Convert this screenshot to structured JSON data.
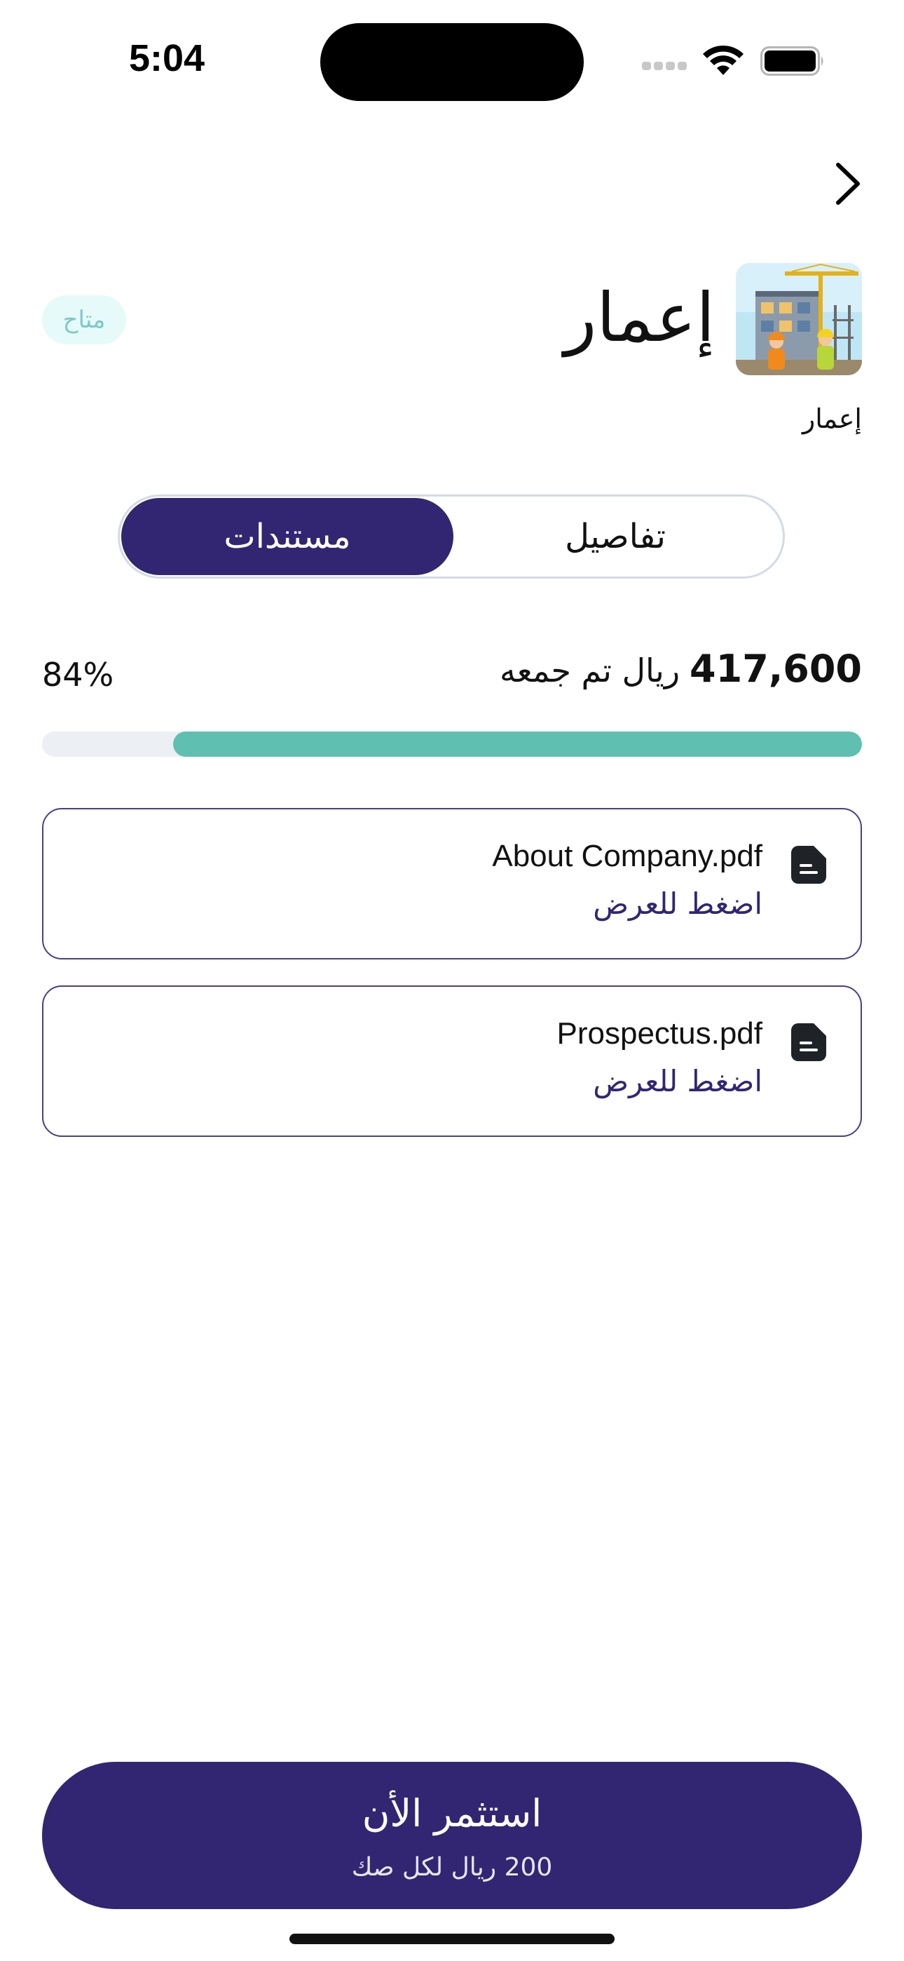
{
  "status_bar": {
    "time": "5:04"
  },
  "header": {
    "back_icon": "chevron-right-icon",
    "company_name": "إعمار",
    "company_subtitle": "إعمار",
    "status_badge": "متاح",
    "logo_icon": "construction-site-image"
  },
  "tabs": {
    "documents": "مستندات",
    "details": "تفاصيل",
    "selected": "documents"
  },
  "funding": {
    "amount": "417,600",
    "label": "ريال تم جمعه",
    "percent_text": "84%",
    "progress": 0.84
  },
  "documents": [
    {
      "name": "About Company.pdf",
      "action": "اضغط للعرض",
      "icon": "document-icon"
    },
    {
      "name": "Prospectus.pdf",
      "action": "اضغط للعرض",
      "icon": "document-icon"
    }
  ],
  "invest": {
    "title": "استثمر الأن",
    "subtitle": "200 ريال لكل صك"
  },
  "colors": {
    "primary": "#322672",
    "progress": "#5fbfb0",
    "track": "#eceff3",
    "badge_bg": "#e6fafa",
    "badge_text": "#7ec9c9"
  }
}
